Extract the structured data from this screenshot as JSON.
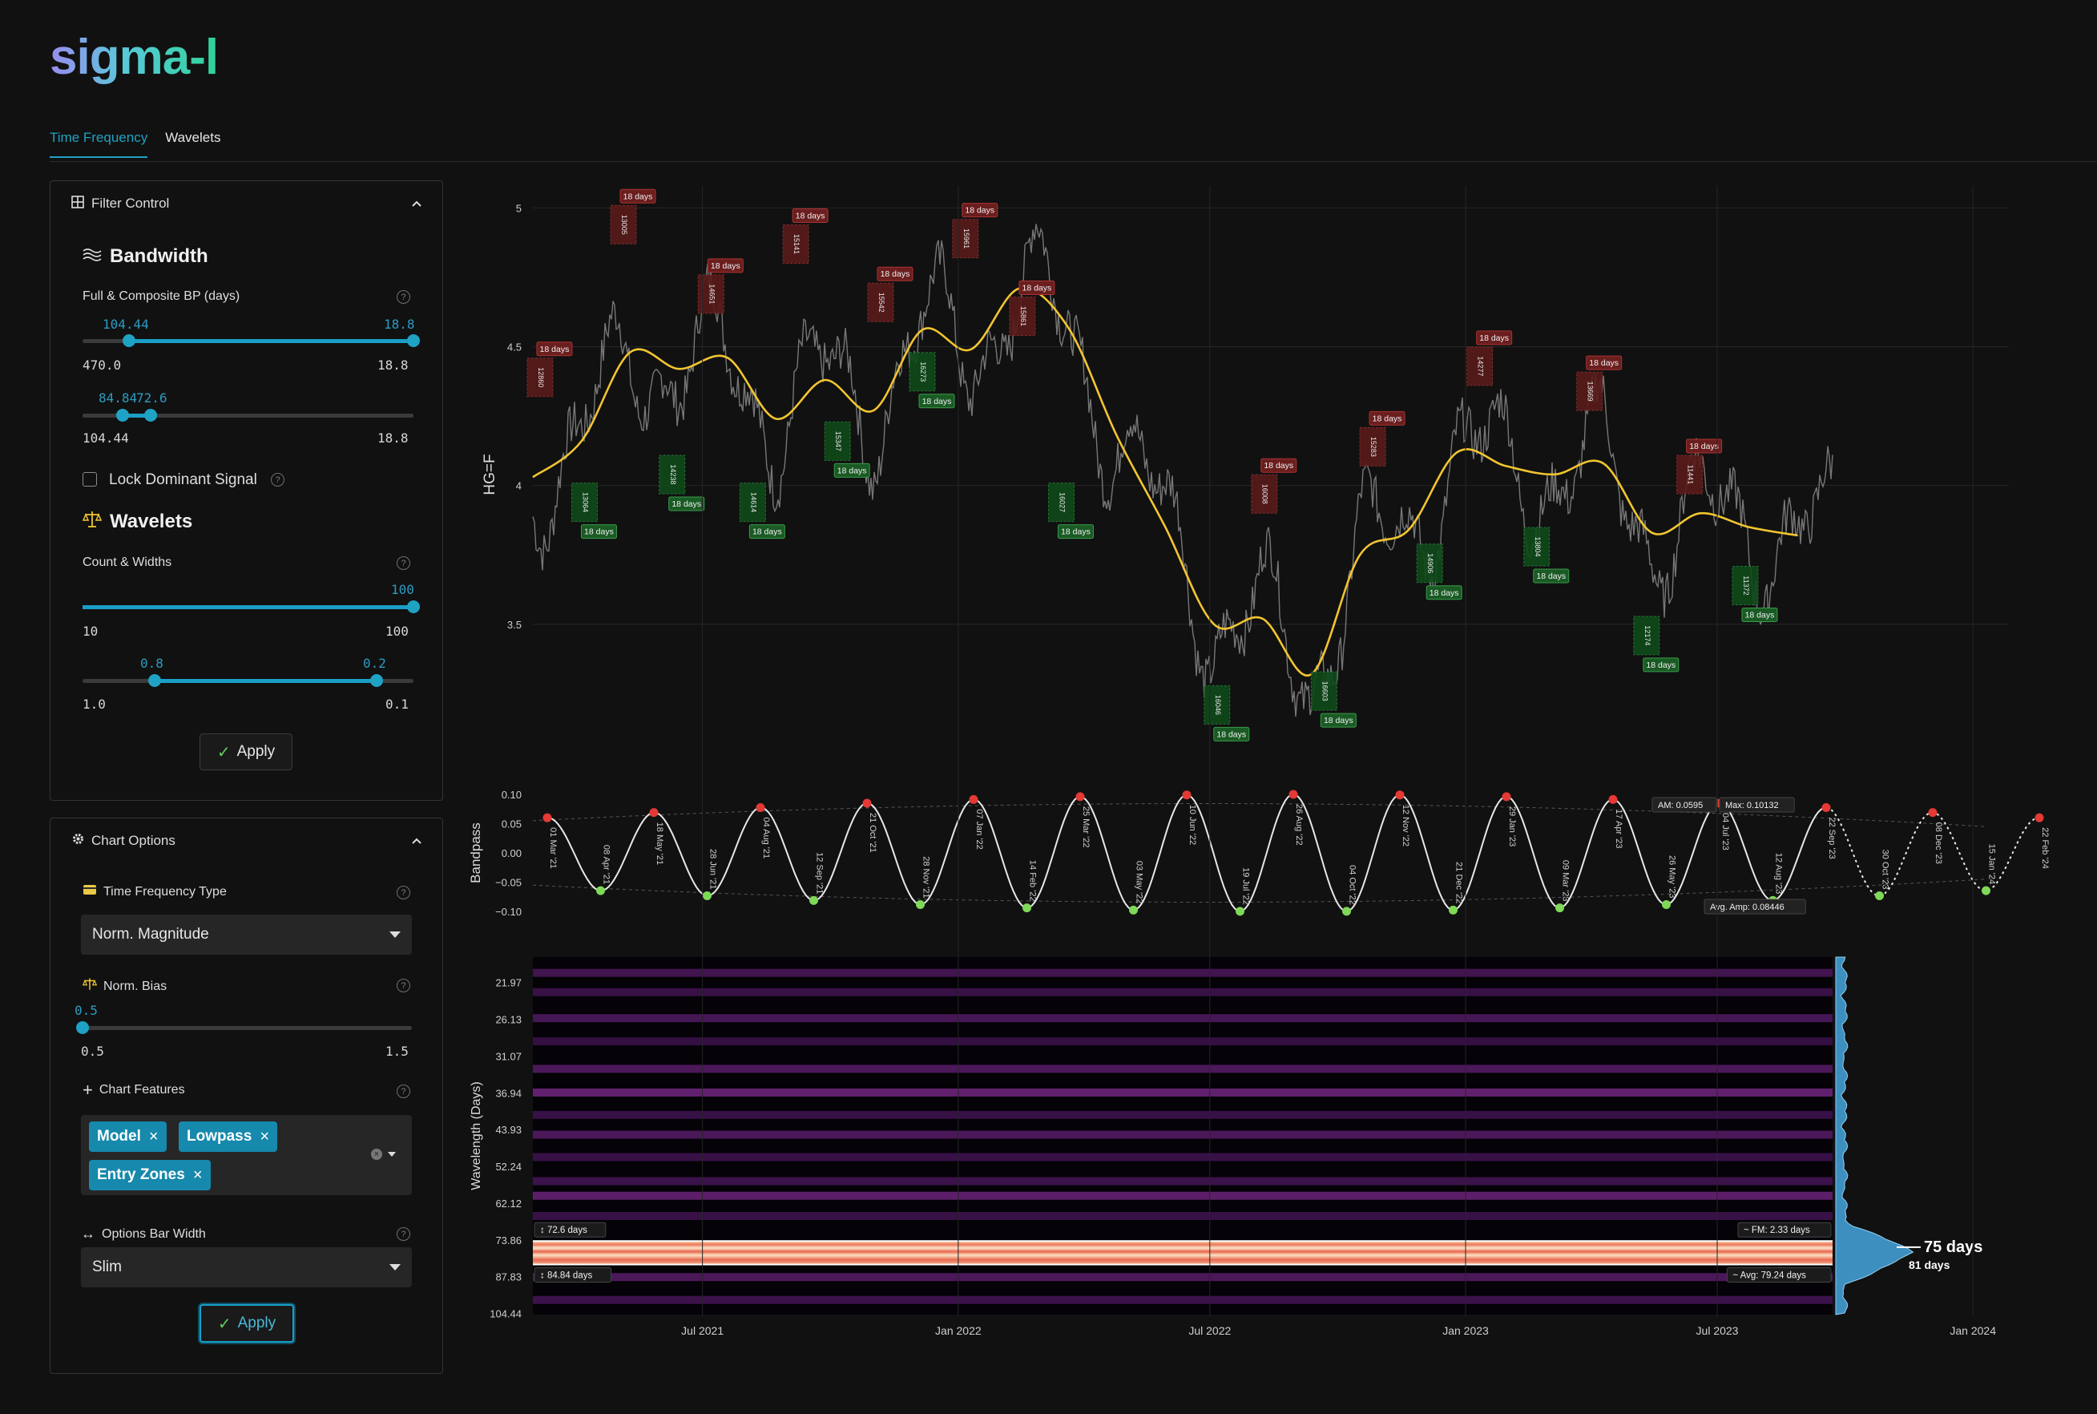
{
  "app": {
    "logo": "sigma-l"
  },
  "tabs": [
    {
      "label": "Time Frequency",
      "active": true
    },
    {
      "label": "Wavelets",
      "active": false
    }
  ],
  "filter_control": {
    "title": "Filter Control",
    "bandwidth": {
      "heading": "Bandwidth",
      "label": "Full & Composite BP (days)",
      "slider1": {
        "left_value": "104.44",
        "right_value": "18.8",
        "min_label": "470.0",
        "max_label": "18.8"
      },
      "slider2": {
        "left_value": "84.84",
        "right_value": "72.6",
        "min_label": "104.44",
        "max_label": "18.8"
      },
      "lock_label": "Lock Dominant Signal",
      "lock_checked": false
    },
    "wavelets": {
      "heading": "Wavelets",
      "label": "Count & Widths",
      "count": {
        "value": "100",
        "min_label": "10",
        "max_label": "100"
      },
      "widths": {
        "left_value": "0.8",
        "right_value": "0.2",
        "min_label": "1.0",
        "max_label": "0.1"
      }
    },
    "apply_label": "Apply"
  },
  "chart_options": {
    "title": "Chart Options",
    "tf_type": {
      "label": "Time Frequency Type",
      "value": "Norm. Magnitude"
    },
    "norm_bias": {
      "label": "Norm. Bias",
      "value": "0.5",
      "min_label": "0.5",
      "max_label": "1.5"
    },
    "features": {
      "label": "Chart Features",
      "chips": [
        "Model",
        "Lowpass",
        "Entry Zones"
      ]
    },
    "bar_width": {
      "label": "Options Bar Width",
      "value": "Slim"
    },
    "apply_label": "Apply"
  },
  "colors": {
    "accent": "#1fa2c4",
    "model": "#f2c530",
    "peak": "#e53935",
    "trough": "#7ed957",
    "high_zone": "#5a1a1a",
    "low_zone": "#0f4a1a"
  },
  "icons": {
    "bandwidth": "wave-icon",
    "wavelets": "balance-icon",
    "filter": "grid-icon",
    "options": "gear-icon"
  },
  "chart_data": [
    {
      "type": "line",
      "ylabel": "HG=F",
      "y_ticks": [
        "5",
        "4.5",
        "4",
        "3.5"
      ],
      "ylim": [
        3.0,
        5.05
      ],
      "xlim": [
        "2021-03-01",
        "2024-03-01"
      ],
      "series": [
        {
          "role": "lowpass",
          "x": [
            "2021-03-01",
            "2021-04-05",
            "2021-05-10",
            "2021-06-14",
            "2021-07-19",
            "2021-08-23",
            "2021-09-27",
            "2021-11-01",
            "2021-12-06",
            "2022-01-10",
            "2022-02-14",
            "2022-03-21",
            "2022-04-25",
            "2022-05-30",
            "2022-07-04",
            "2022-08-08",
            "2022-09-12",
            "2022-10-17",
            "2022-11-21",
            "2022-12-26",
            "2023-01-30",
            "2023-03-06",
            "2023-04-10",
            "2023-05-15",
            "2023-06-19",
            "2023-07-24",
            "2023-08-28"
          ],
          "values": [
            4.03,
            4.16,
            4.48,
            4.42,
            4.46,
            4.24,
            4.38,
            4.27,
            4.56,
            4.49,
            4.71,
            4.57,
            4.18,
            3.85,
            3.5,
            3.52,
            3.32,
            3.75,
            3.84,
            4.12,
            4.07,
            4.04,
            4.08,
            3.83,
            3.9,
            3.85,
            3.82
          ]
        }
      ],
      "entry_zones": [
        {
          "type": "high",
          "label": "18 days",
          "id": "12860",
          "x": "2021-03-05",
          "y": 4.3
        },
        {
          "type": "low",
          "label": "18 days",
          "id": "13064",
          "x": "2021-04-06",
          "y": 3.98
        },
        {
          "type": "high",
          "label": "18 days",
          "id": "13005",
          "x": "2021-05-04",
          "y": 4.85
        },
        {
          "type": "low",
          "label": "18 days",
          "id": "14238",
          "x": "2021-06-08",
          "y": 4.08
        },
        {
          "type": "high",
          "label": "18 days",
          "id": "14651",
          "x": "2021-07-06",
          "y": 4.6
        },
        {
          "type": "low",
          "label": "18 days",
          "id": "14614",
          "x": "2021-08-05",
          "y": 3.98
        },
        {
          "type": "high",
          "label": "18 days",
          "id": "15141",
          "x": "2021-09-05",
          "y": 4.78
        },
        {
          "type": "low",
          "label": "18 days",
          "id": "15347",
          "x": "2021-10-05",
          "y": 4.2
        },
        {
          "type": "high",
          "label": "18 days",
          "id": "15542",
          "x": "2021-11-05",
          "y": 4.57
        },
        {
          "type": "low",
          "label": "18 days",
          "id": "16273",
          "x": "2021-12-05",
          "y": 4.45
        },
        {
          "type": "high",
          "label": "18 days",
          "id": "15961",
          "x": "2022-01-05",
          "y": 4.8
        },
        {
          "type": "high",
          "label": "18 days",
          "id": "15861",
          "x": "2022-02-15",
          "y": 4.52
        },
        {
          "type": "low",
          "label": "18 days",
          "id": "16027",
          "x": "2022-03-15",
          "y": 3.98
        },
        {
          "type": "low",
          "label": "18 days",
          "id": "16046",
          "x": "2022-07-05",
          "y": 3.25
        },
        {
          "type": "high",
          "label": "18 days",
          "id": "16008",
          "x": "2022-08-08",
          "y": 3.88
        },
        {
          "type": "low",
          "label": "18 days",
          "id": "16603",
          "x": "2022-09-20",
          "y": 3.3
        },
        {
          "type": "high",
          "label": "18 days",
          "id": "15283",
          "x": "2022-10-25",
          "y": 4.05
        },
        {
          "type": "low",
          "label": "18 days",
          "id": "14906",
          "x": "2022-12-05",
          "y": 3.76
        },
        {
          "type": "high",
          "label": "18 days",
          "id": "14277",
          "x": "2023-01-10",
          "y": 4.34
        },
        {
          "type": "low",
          "label": "18 days",
          "id": "13804",
          "x": "2023-02-20",
          "y": 3.82
        },
        {
          "type": "high",
          "label": "18 days",
          "id": "13669",
          "x": "2023-03-30",
          "y": 4.25
        },
        {
          "type": "low",
          "label": "18 days",
          "id": "12174",
          "x": "2023-05-10",
          "y": 3.5
        },
        {
          "type": "high",
          "label": "18 days",
          "id": "11441",
          "x": "2023-06-10",
          "y": 3.95
        },
        {
          "type": "low",
          "label": "18 days",
          "id": "11372",
          "x": "2023-07-20",
          "y": 3.68
        }
      ],
      "x_ticks": [
        "Jul 2021",
        "Jan 2022",
        "Jul 2022",
        "Jan 2023",
        "Jul 2023",
        "Jan 2024"
      ]
    },
    {
      "type": "line",
      "ylabel": "Bandpass",
      "y_ticks": [
        "0.10",
        "0.05",
        "0.00",
        "−0.05",
        "−0.10"
      ],
      "ylim": [
        -0.115,
        0.115
      ],
      "turning_points": [
        {
          "label": "01 Mar '21",
          "kind": "peak"
        },
        {
          "label": "08 Apr '21",
          "kind": "trough"
        },
        {
          "label": "18 May '21",
          "kind": "peak"
        },
        {
          "label": "28 Jun '21",
          "kind": "trough"
        },
        {
          "label": "04 Aug '21",
          "kind": "peak"
        },
        {
          "label": "12 Sep '21",
          "kind": "trough"
        },
        {
          "label": "21 Oct '21",
          "kind": "peak"
        },
        {
          "label": "28 Nov '21",
          "kind": "trough"
        },
        {
          "label": "07 Jan '22",
          "kind": "peak"
        },
        {
          "label": "14 Feb '22",
          "kind": "trough"
        },
        {
          "label": "25 Mar '22",
          "kind": "peak"
        },
        {
          "label": "03 May '22",
          "kind": "trough"
        },
        {
          "label": "10 Jun '22",
          "kind": "peak"
        },
        {
          "label": "19 Jul '22",
          "kind": "trough"
        },
        {
          "label": "26 Aug '22",
          "kind": "peak"
        },
        {
          "label": "04 Oct '22",
          "kind": "trough"
        },
        {
          "label": "12 Nov '22",
          "kind": "peak"
        },
        {
          "label": "21 Dec '22",
          "kind": "trough"
        },
        {
          "label": "29 Jan '23",
          "kind": "peak"
        },
        {
          "label": "09 Mar '23",
          "kind": "trough"
        },
        {
          "label": "17 Apr '23",
          "kind": "peak"
        },
        {
          "label": "26 May '23",
          "kind": "trough"
        },
        {
          "label": "04 Jul '23",
          "kind": "peak"
        },
        {
          "label": "12 Aug '23",
          "kind": "trough"
        },
        {
          "label": "22 Sep '23",
          "kind": "peak"
        },
        {
          "label": "30 Oct '23",
          "kind": "trough"
        },
        {
          "label": "08 Dec '23",
          "kind": "peak"
        },
        {
          "label": "15 Jan '24",
          "kind": "trough"
        },
        {
          "label": "22 Feb '24",
          "kind": "peak"
        }
      ],
      "annotations": {
        "am": "AM: 0.0595",
        "max": "Max: 0.10132",
        "avg_amp": "Avg. Amp: 0.08446"
      }
    },
    {
      "type": "heatmap",
      "ylabel": "Wavelength (Days)",
      "y_ticks": [
        "21.97",
        "26.13",
        "31.07",
        "36.94",
        "43.93",
        "52.24",
        "62.12",
        "73.86",
        "87.83",
        "104.44"
      ],
      "bands": [
        {
          "wavelength": 21.0,
          "intensity": 0.45
        },
        {
          "wavelength": 23.0,
          "intensity": 0.35
        },
        {
          "wavelength": 26.0,
          "intensity": 0.5
        },
        {
          "wavelength": 29.0,
          "intensity": 0.3
        },
        {
          "wavelength": 33.0,
          "intensity": 0.55
        },
        {
          "wavelength": 36.9,
          "intensity": 0.75
        },
        {
          "wavelength": 41.0,
          "intensity": 0.35
        },
        {
          "wavelength": 45.0,
          "intensity": 0.55
        },
        {
          "wavelength": 50.0,
          "intensity": 0.35
        },
        {
          "wavelength": 56.0,
          "intensity": 0.4
        },
        {
          "wavelength": 60.0,
          "intensity": 0.7
        },
        {
          "wavelength": 66.0,
          "intensity": 0.35
        },
        {
          "wavelength": 75.0,
          "intensity": 1.0
        },
        {
          "wavelength": 88.0,
          "intensity": 0.55
        },
        {
          "wavelength": 98.0,
          "intensity": 0.4
        }
      ],
      "annotations": {
        "upper": "72.6 days",
        "lower": "84.84 days",
        "fm": "FM: 2.33 days",
        "avg": "Avg: 79.24 days",
        "dominant": "75 days",
        "secondary": "81 days"
      }
    }
  ]
}
